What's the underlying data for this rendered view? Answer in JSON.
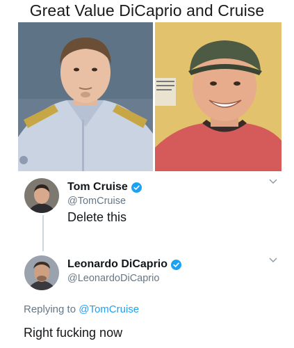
{
  "meme": {
    "title": "Great Value DiCaprio and Cruise"
  },
  "photos": {
    "left_icon": "person-photo",
    "right_icon": "person-photo"
  },
  "tweets": [
    {
      "display_name": "Tom Cruise",
      "handle": "@TomCruise",
      "text": "Delete this",
      "verified_icon": "verified-badge-icon",
      "menu_icon": "chevron-down-icon"
    },
    {
      "display_name": "Leonardo DiCaprio",
      "handle": "@LeonardoDiCaprio",
      "replying_to_prefix": "Replying to",
      "replying_to_handle": "@TomCruise",
      "text": "Right fucking now",
      "verified_icon": "verified-badge-icon",
      "menu_icon": "chevron-down-icon"
    }
  ],
  "colors": {
    "verified": "#1da1f2",
    "mention": "#1da1f2",
    "handle": "#657786",
    "thread_line": "#ccd6dd"
  }
}
